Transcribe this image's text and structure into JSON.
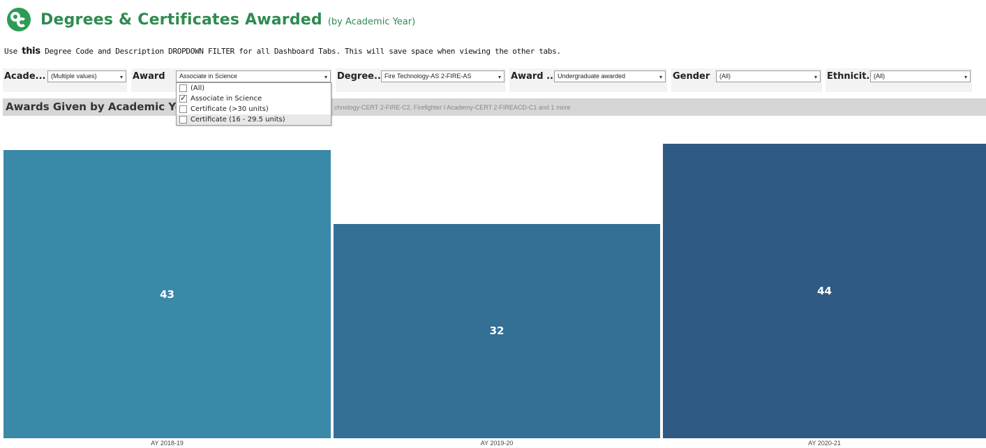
{
  "header": {
    "title": "Degrees & Certificates Awarded",
    "subtitle": "(by Academic Year)",
    "logo_icon": "cc-logo-icon"
  },
  "instruction": {
    "prefix": "Use ",
    "emphasis": "this",
    "rest": " Degree Code and Description DROPDOWN FILTER for all Dashboard Tabs. This will save space when viewing the other tabs."
  },
  "filters": [
    {
      "label": "Acade...",
      "value": "(Multiple values)"
    },
    {
      "label": "Award",
      "value": "Associate in Science"
    },
    {
      "label": "Degree...",
      "value": "Fire Technology-AS 2-FIRE-AS"
    },
    {
      "label": "Award ...",
      "value": "Undergraduate awarded"
    },
    {
      "label": "Gender",
      "value": "(All)"
    },
    {
      "label": "Ethnicit...",
      "value": "(All)"
    }
  ],
  "dropdown_arrow": "▾",
  "award_dropdown": {
    "items": [
      {
        "label": "(All)",
        "checked": false
      },
      {
        "label": "Associate in Science",
        "checked": true
      },
      {
        "label": "Certificate (>30 units)",
        "checked": false
      },
      {
        "label": "Certificate (16 - 29.5 units)",
        "checked": false
      }
    ]
  },
  "sheet": {
    "title": "Awards Given by Academic Yea",
    "subtitle": "chnology-CERT 2-FIRE-C2, Firefighter I Academy-CERT 2-FIREACD-C1 and 1 more"
  },
  "chart_data": {
    "type": "bar",
    "categories": [
      "AY 2018-19",
      "AY 2019-20",
      "AY 2020-21"
    ],
    "values": [
      43,
      32,
      44
    ],
    "colors": [
      "#3a89a9",
      "#346f95",
      "#2e5a84"
    ],
    "title": "",
    "xlabel": "",
    "ylabel": ""
  }
}
